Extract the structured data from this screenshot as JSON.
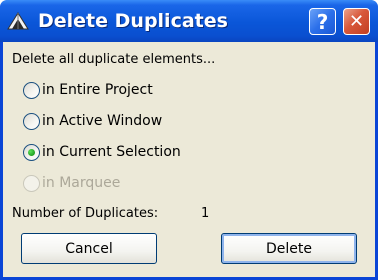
{
  "window": {
    "title": "Delete Duplicates",
    "help_label": "?",
    "close_label": "✕"
  },
  "dialog": {
    "heading": "Delete all duplicate elements...",
    "options": [
      {
        "label": "in Entire Project",
        "checked": false,
        "enabled": true
      },
      {
        "label": "in Active Window",
        "checked": false,
        "enabled": true
      },
      {
        "label": "in Current Selection",
        "checked": true,
        "enabled": true
      },
      {
        "label": "in Marquee",
        "checked": false,
        "enabled": false
      }
    ],
    "count_label": "Number of Duplicates:",
    "count_value": "1",
    "cancel_label": "Cancel",
    "delete_label": "Delete"
  },
  "colors": {
    "title_bar": "#0a56d8",
    "client_bg": "#ece9d8",
    "close_button": "#d8583a",
    "checked_dot": "#21a121",
    "disabled_text": "#aca899"
  },
  "icons": {
    "app": "duplicates-app-icon",
    "help": "help-icon",
    "close": "close-icon"
  }
}
